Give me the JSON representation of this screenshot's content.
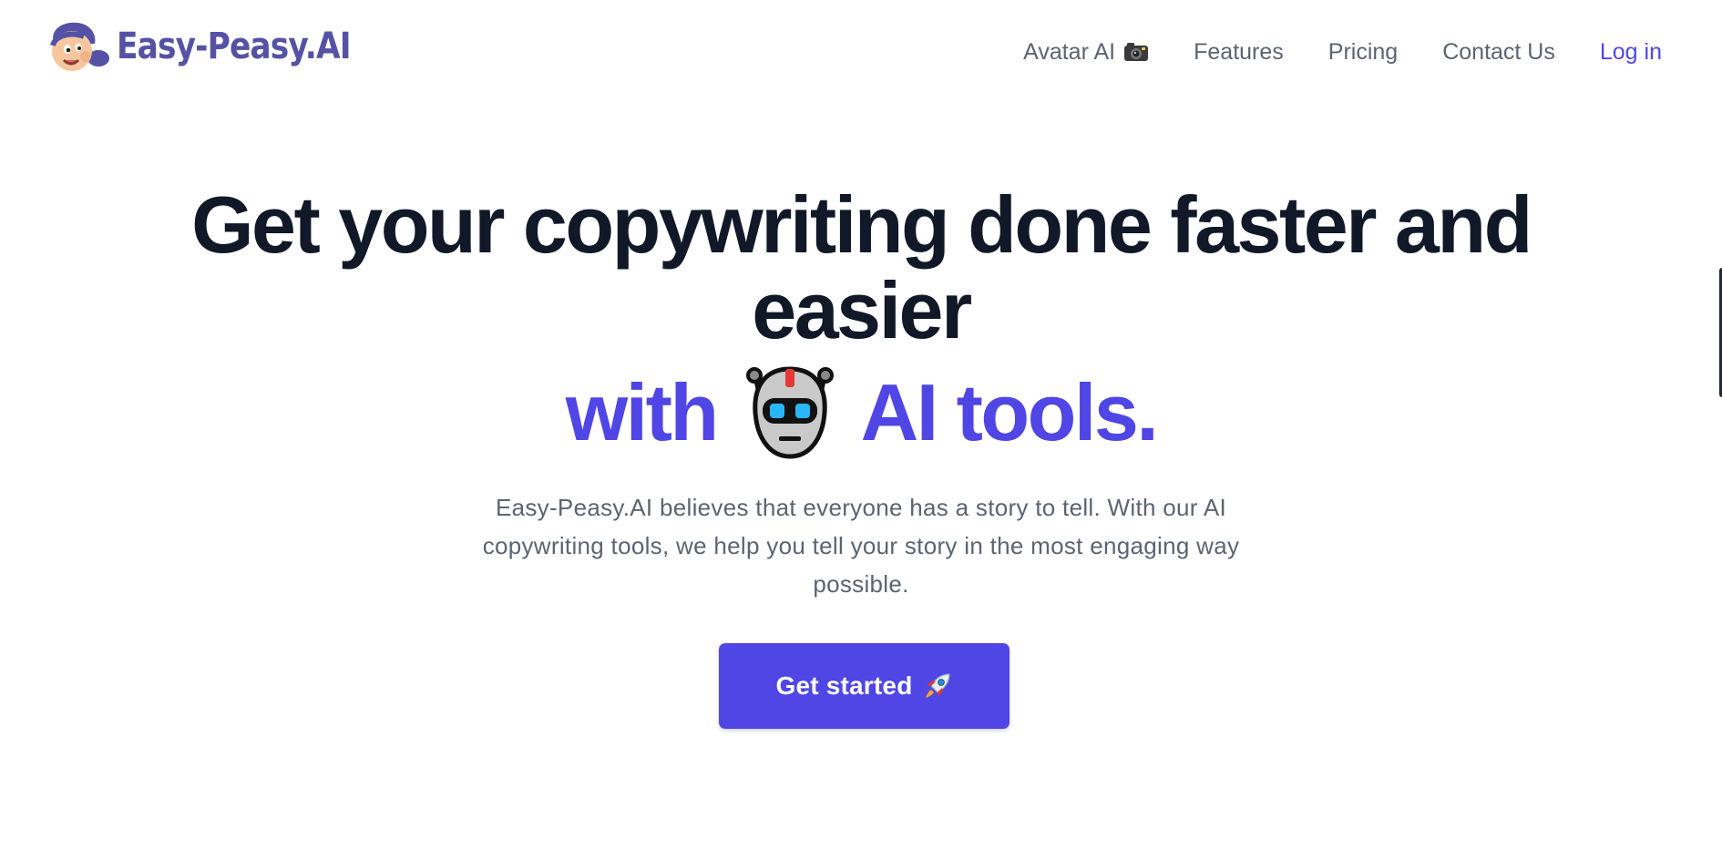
{
  "brand": {
    "name": "Easy-Peasy.AI",
    "text_color": "#5552a6",
    "logo_icon": "mascot-logo-icon"
  },
  "nav": {
    "items": [
      {
        "label": "Avatar AI",
        "icon": "camera-icon"
      },
      {
        "label": "Features"
      },
      {
        "label": "Pricing"
      },
      {
        "label": "Contact Us"
      }
    ],
    "login_label": "Log in",
    "text_color": "#5b6472",
    "login_color": "#4f46e5"
  },
  "hero": {
    "title_line1": "Get your copywriting done faster and",
    "title_line2": "easier",
    "accent_before": "with",
    "accent_icon": "robot-icon",
    "accent_after": "AI tools.",
    "description": "Easy-Peasy.AI believes that everyone has a story to tell. With our AI copywriting tools, we help you tell your story in the most engaging way possible.",
    "title_color": "#111827",
    "accent_color": "#4f46e5"
  },
  "cta": {
    "label": "Get started",
    "icon": "rocket-icon",
    "background": "#4f46e5"
  }
}
